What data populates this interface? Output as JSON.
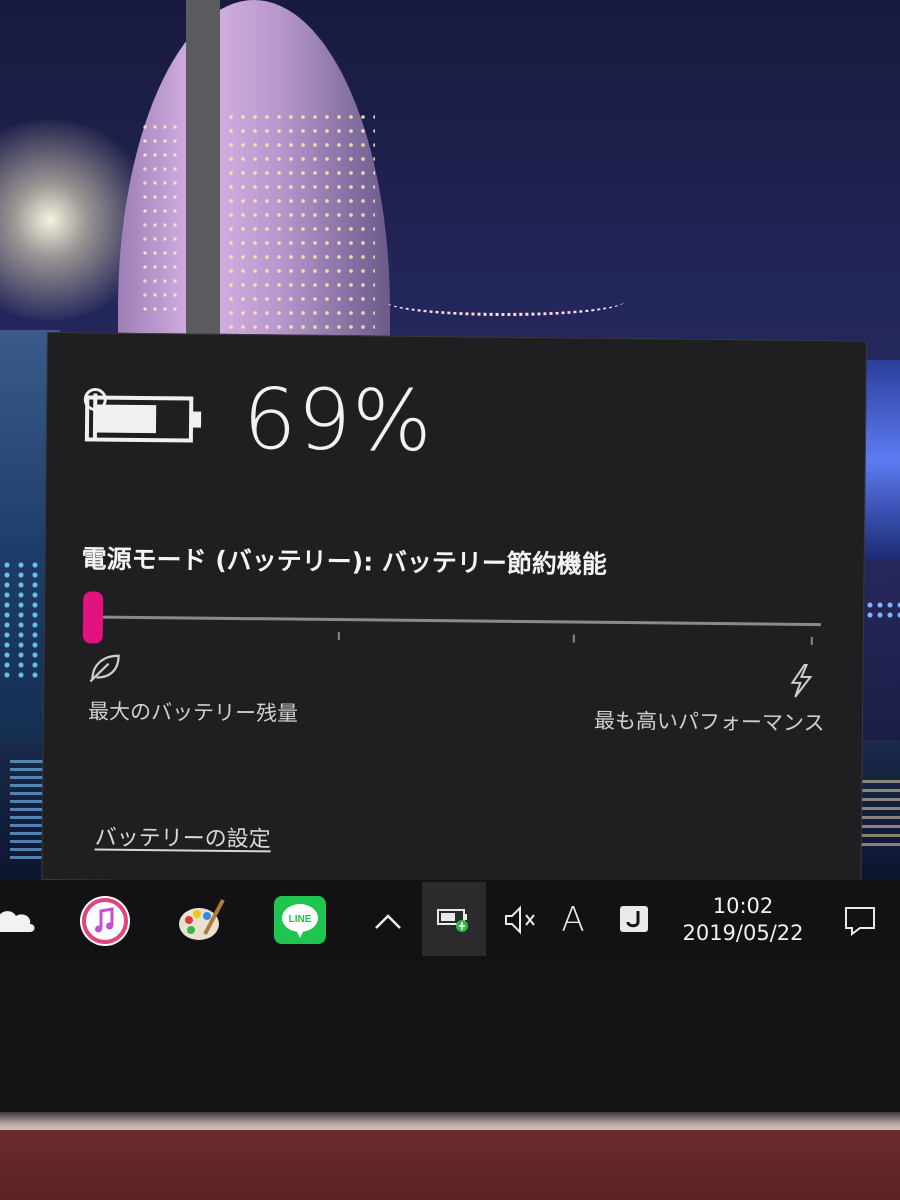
{
  "battery": {
    "percent_text": "69%",
    "level": 0.69
  },
  "power_mode": {
    "label": "電源モード (バッテリー): バッテリー節約機能",
    "slider_value": 0,
    "min_label": "最大のバッテリー残量",
    "max_label": "最も高いパフォーマンス",
    "accent_color": "#e2127f"
  },
  "settings_link": "バッテリーの設定",
  "taskbar": {
    "items": [
      "onedrive-icon",
      "itunes-icon",
      "paint-icon",
      "line-icon"
    ],
    "line_label": "LINE",
    "tray": [
      "chevron-up-icon",
      "battery-charging-icon",
      "volume-mute-icon",
      "ime-indicator",
      "ime-j-icon"
    ],
    "ime_text": "A",
    "clock": {
      "time": "10:02",
      "date": "2019/05/22"
    }
  },
  "colors": {
    "flyout_bg": "#1f1f21",
    "taskbar_bg": "#121214",
    "line_green": "#1fc54e"
  }
}
